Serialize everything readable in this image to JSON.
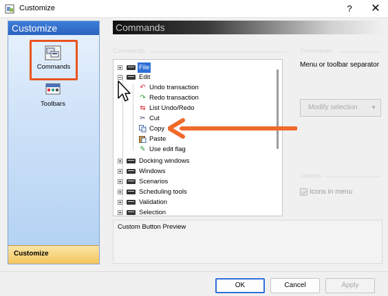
{
  "window": {
    "title": "Customize",
    "help_glyph": "?",
    "close_glyph": "✕"
  },
  "sidebar": {
    "header": "Customize",
    "items": [
      {
        "label": "Commands",
        "icon": "commands-icon",
        "highlighted": true
      },
      {
        "label": "Toolbars",
        "icon": "toolbars-icon",
        "highlighted": false
      }
    ],
    "footer": "Customize"
  },
  "commands_panel": {
    "header": "Commands",
    "tree_group_label": "Commands",
    "tree": [
      {
        "label": "File",
        "type": "folder",
        "expanded": false,
        "selected": true
      },
      {
        "label": "Edit",
        "type": "folder",
        "expanded": true,
        "selected": false,
        "children": [
          {
            "label": "Undo transaction",
            "icon": "undo-icon"
          },
          {
            "label": "Redo transaction",
            "icon": "redo-icon"
          },
          {
            "label": "List Undo/Redo",
            "icon": "list-undo-redo-icon"
          },
          {
            "label": "Cut",
            "icon": "scissors-icon"
          },
          {
            "label": "Copy",
            "icon": "copy-icon"
          },
          {
            "label": "Paste",
            "icon": "paste-icon"
          },
          {
            "label": "Use edit flag",
            "icon": "edit-flag-icon"
          }
        ]
      },
      {
        "label": "Docking windows",
        "type": "folder",
        "expanded": false
      },
      {
        "label": "Windows",
        "type": "folder",
        "expanded": false
      },
      {
        "label": "Scenarios",
        "type": "folder",
        "expanded": false
      },
      {
        "label": "Scheduling tools",
        "type": "folder",
        "expanded": false
      },
      {
        "label": "Validation",
        "type": "folder",
        "expanded": false
      },
      {
        "label": "Selection",
        "type": "folder",
        "expanded": false
      }
    ]
  },
  "properties": {
    "group_label": "Commands",
    "selected_text": "Menu or toolbar separator",
    "modify_button": "Modify selection",
    "modify_dropdown_glyph": "▼",
    "options_group_label": "Options",
    "icons_in_menu": {
      "label": "Icons in menu",
      "checked": true,
      "enabled": false
    }
  },
  "preview": {
    "label": "Custom Button Preview"
  },
  "buttons": {
    "ok": "OK",
    "cancel": "Cancel",
    "apply": "Apply"
  },
  "colors": {
    "highlight_box": "#e8531f",
    "arrow": "#f06a2b",
    "selection": "#2d6fd6"
  }
}
